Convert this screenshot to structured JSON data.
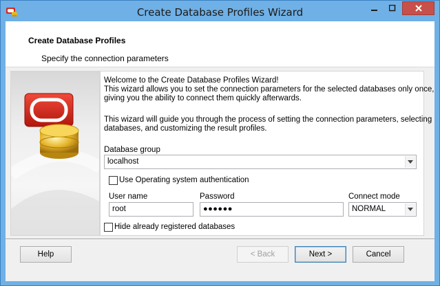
{
  "window": {
    "title": "Create Database Profiles Wizard",
    "accent_color": "#6fb0e6",
    "close_color": "#c7504a"
  },
  "header": {
    "title": "Create Database Profiles",
    "subtitle": "Specify the connection parameters"
  },
  "intro": {
    "line1": "Welcome to the Create Database Profiles Wizard!",
    "line2": "This wizard allows you to set the connection parameters for the selected databases only once,",
    "line3": "giving you the ability to connect them quickly afterwards.",
    "line4": "This wizard will guide you through the process of setting the connection parameters, selecting",
    "line5": "databases, and customizing the result profiles."
  },
  "form": {
    "database_group_label": "Database group",
    "database_group_value": "localhost",
    "os_auth_label": "Use Operating system authentication",
    "os_auth_checked": false,
    "user_name_label": "User name",
    "user_name_value": "root",
    "password_label": "Password",
    "password_value": "●●●●●●",
    "connect_mode_label": "Connect mode",
    "connect_mode_value": "NORMAL",
    "hide_registered_label": "Hide already registered databases",
    "hide_registered_checked": false
  },
  "buttons": {
    "help": "Help",
    "back": "< Back",
    "next": "Next >",
    "cancel": "Cancel"
  },
  "icons": {
    "app": "database-app-icon",
    "logo": "database-logo-icon"
  }
}
